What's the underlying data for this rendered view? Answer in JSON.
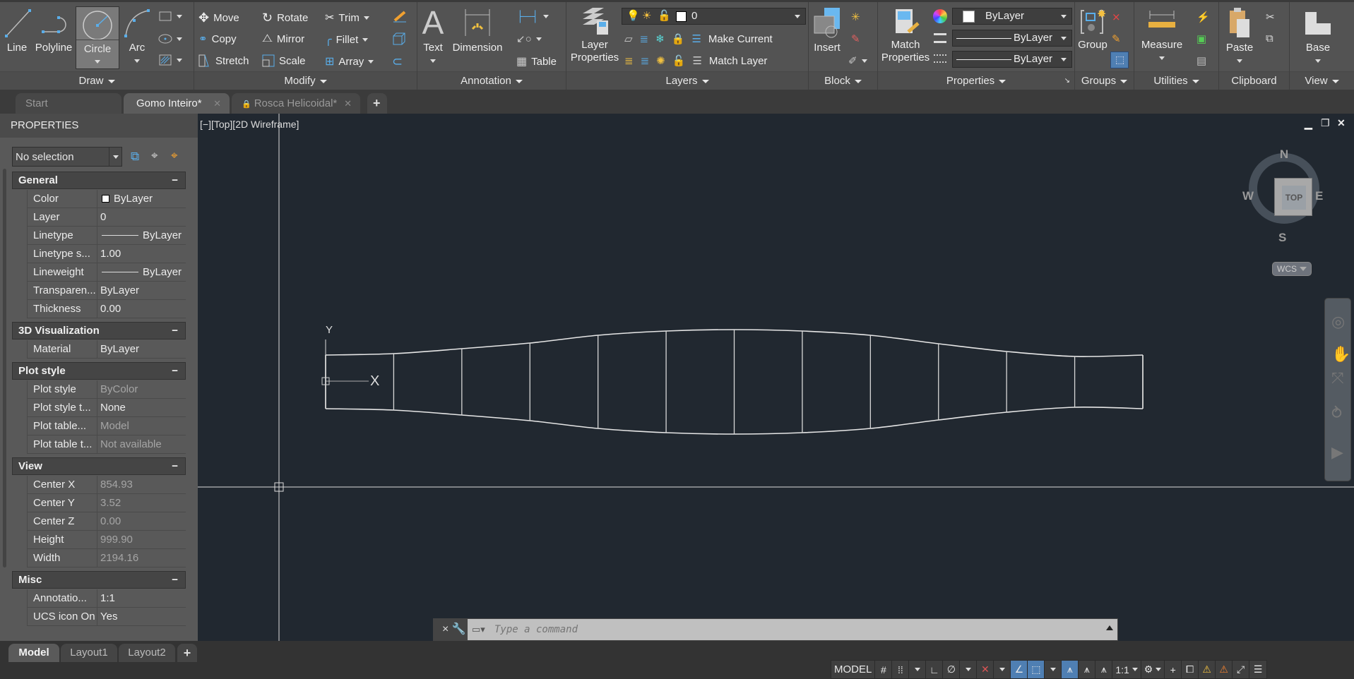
{
  "ribbon": {
    "draw": {
      "title": "Draw",
      "line": "Line",
      "polyline": "Polyline",
      "circle": "Circle",
      "arc": "Arc"
    },
    "modify": {
      "title": "Modify",
      "move": "Move",
      "rotate": "Rotate",
      "trim": "Trim",
      "copy": "Copy",
      "mirror": "Mirror",
      "fillet": "Fillet",
      "stretch": "Stretch",
      "scale": "Scale",
      "array": "Array"
    },
    "annotation": {
      "title": "Annotation",
      "text": "Text",
      "dimension": "Dimension",
      "table": "Table"
    },
    "layers": {
      "title": "Layers",
      "layer_properties_line1": "Layer",
      "layer_properties_line2": "Properties",
      "current_layer": "0",
      "make_current": "Make Current",
      "match_layer": "Match Layer"
    },
    "block": {
      "title": "Block",
      "insert": "Insert"
    },
    "properties": {
      "title": "Properties",
      "match_line1": "Match",
      "match_line2": "Properties",
      "color": "ByLayer",
      "linetype": "ByLayer",
      "lineweight": "ByLayer"
    },
    "groups": {
      "title": "Groups",
      "group": "Group"
    },
    "utilities": {
      "title": "Utilities",
      "measure": "Measure"
    },
    "clipboard": {
      "title": "Clipboard",
      "paste": "Paste"
    },
    "view": {
      "title": "View",
      "base": "Base"
    }
  },
  "doc_tabs": [
    {
      "label": "Start",
      "active": false
    },
    {
      "label": "Gomo Inteiro*",
      "active": true
    },
    {
      "label": "Rosca Helicoidal*",
      "active": false,
      "locked": true
    }
  ],
  "properties_panel": {
    "title": "PROPERTIES",
    "selection": "No selection",
    "sections": {
      "general": {
        "title": "General",
        "rows": [
          {
            "key": "Color",
            "value": "ByLayer"
          },
          {
            "key": "Layer",
            "value": "0"
          },
          {
            "key": "Linetype",
            "value": "ByLayer"
          },
          {
            "key": "Linetype s...",
            "value": "1.00"
          },
          {
            "key": "Lineweight",
            "value": "ByLayer"
          },
          {
            "key": "Transparen...",
            "value": "ByLayer"
          },
          {
            "key": "Thickness",
            "value": "0.00"
          }
        ]
      },
      "visualization": {
        "title": "3D Visualization",
        "rows": [
          {
            "key": "Material",
            "value": "ByLayer"
          }
        ]
      },
      "plot_style": {
        "title": "Plot style",
        "rows": [
          {
            "key": "Plot style",
            "value": "ByColor"
          },
          {
            "key": "Plot style t...",
            "value": "None"
          },
          {
            "key": "Plot table...",
            "value": "Model"
          },
          {
            "key": "Plot table t...",
            "value": "Not available"
          }
        ]
      },
      "view": {
        "title": "View",
        "rows": [
          {
            "key": "Center X",
            "value": "854.93"
          },
          {
            "key": "Center Y",
            "value": "3.52"
          },
          {
            "key": "Center Z",
            "value": "0.00"
          },
          {
            "key": "Height",
            "value": "999.90"
          },
          {
            "key": "Width",
            "value": "2194.16"
          }
        ]
      },
      "misc": {
        "title": "Misc",
        "rows": [
          {
            "key": "Annotatio...",
            "value": "1:1"
          },
          {
            "key": "UCS icon On",
            "value": "Yes"
          }
        ]
      }
    }
  },
  "viewport": {
    "label": "[−][Top][2D Wireframe]",
    "ucs_x": "X",
    "ucs_y": "Y",
    "viewcube": {
      "face": "TOP",
      "n": "N",
      "s": "S",
      "e": "E",
      "w": "W",
      "coord": "WCS"
    }
  },
  "command_line": {
    "placeholder": "Type a command"
  },
  "layout_tabs": [
    "Model",
    "Layout1",
    "Layout2"
  ],
  "status_bar": {
    "model": "MODEL",
    "scale": "1:1"
  },
  "colors": {
    "accent": "#4f7fb3",
    "canvas": "#212830",
    "ribbon": "#535353"
  }
}
